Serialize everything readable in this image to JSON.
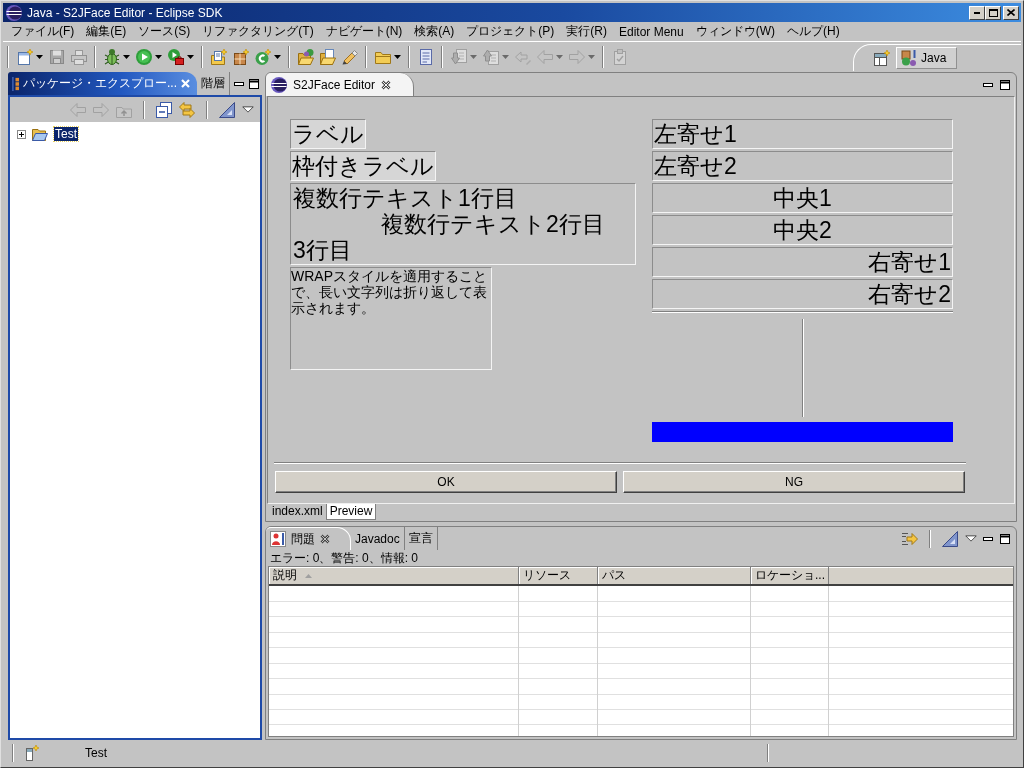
{
  "window": {
    "title": "Java - S2JFace Editor - Eclipse SDK"
  },
  "menu": [
    "ファイル(F)",
    "編集(E)",
    "ソース(S)",
    "リファクタリング(T)",
    "ナビゲート(N)",
    "検索(A)",
    "プロジェクト(P)",
    "実行(R)",
    "Editor Menu",
    "ウィンドウ(W)",
    "ヘルプ(H)"
  ],
  "toolbar": [
    {
      "items": [
        {
          "kind": "new",
          "dropdown": true,
          "disabled": false
        },
        {
          "kind": "save",
          "dropdown": false,
          "disabled": true
        },
        {
          "kind": "print",
          "dropdown": false,
          "disabled": true
        }
      ]
    },
    {
      "items": [
        {
          "kind": "debug",
          "dropdown": true,
          "disabled": false
        },
        {
          "kind": "run",
          "dropdown": true,
          "disabled": false
        },
        {
          "kind": "external-tools",
          "dropdown": true,
          "disabled": false
        }
      ]
    },
    {
      "items": [
        {
          "kind": "new-project",
          "dropdown": false,
          "disabled": false
        },
        {
          "kind": "new-package",
          "dropdown": false,
          "disabled": false
        },
        {
          "kind": "new-class",
          "dropdown": true,
          "disabled": false
        }
      ]
    },
    {
      "items": [
        {
          "kind": "open-type",
          "dropdown": false,
          "disabled": false
        },
        {
          "kind": "open-resource",
          "dropdown": false,
          "disabled": false
        },
        {
          "kind": "brush",
          "dropdown": false,
          "disabled": false
        }
      ]
    },
    {
      "items": [
        {
          "kind": "folder",
          "dropdown": true,
          "disabled": false
        }
      ]
    },
    {
      "items": [
        {
          "kind": "tasks",
          "dropdown": false,
          "disabled": false
        }
      ]
    },
    {
      "items": [
        {
          "kind": "next",
          "dropdown": true,
          "disabled": true
        },
        {
          "kind": "prev",
          "dropdown": true,
          "disabled": true
        },
        {
          "kind": "last-edit",
          "dropdown": false,
          "disabled": true
        },
        {
          "kind": "back",
          "dropdown": true,
          "disabled": true
        },
        {
          "kind": "forward",
          "dropdown": true,
          "disabled": true
        }
      ]
    },
    {
      "items": [
        {
          "kind": "pin",
          "dropdown": false,
          "disabled": true
        }
      ]
    }
  ],
  "perspectives": [
    {
      "label": "Java",
      "selected": true
    }
  ],
  "left_view": {
    "tabs": [
      {
        "label": "パッケージ・エクスプロー...",
        "selected": true
      },
      {
        "label": "階層",
        "selected": false
      }
    ],
    "toolbar": [
      {
        "items": [
          {
            "kind": "back",
            "disabled": true
          },
          {
            "kind": "forward",
            "disabled": true
          },
          {
            "kind": "up",
            "disabled": true
          }
        ]
      },
      {
        "items": [
          {
            "kind": "collapse-all",
            "disabled": false
          },
          {
            "kind": "link",
            "disabled": false
          }
        ]
      },
      {
        "items": [
          {
            "kind": "set-square",
            "disabled": false
          },
          {
            "kind": "view-menu",
            "disabled": false
          }
        ]
      }
    ],
    "tree": [
      {
        "label": "Test",
        "selected": true,
        "expanded": false
      }
    ]
  },
  "editor": {
    "tabs": [
      {
        "label": "S2JFace Editor",
        "selected": true
      }
    ],
    "preview": {
      "labels": [
        "ラベル",
        "枠付きラベル"
      ],
      "multiline_lines": [
        {
          "text": "複数行テキスト1行目",
          "indented": false
        },
        {
          "text": "複数行テキスト2行目",
          "indented": true
        },
        {
          "text": "3行目",
          "indented": false
        }
      ],
      "wrap_text": "WRAPスタイルを適用することで、長い文字列は折り返して表示されます。",
      "aligned_labels": [
        {
          "text": "左寄せ1",
          "kind": "left"
        },
        {
          "text": "左寄せ2",
          "kind": "left"
        },
        {
          "text": "中央1",
          "kind": "center"
        },
        {
          "text": "中央2",
          "kind": "center"
        },
        {
          "text": "右寄せ1",
          "kind": "right"
        },
        {
          "text": "右寄せ2",
          "kind": "right"
        }
      ],
      "buttons": [
        "OK",
        "NG"
      ]
    },
    "pages": [
      {
        "label": "index.xml",
        "selected": false
      },
      {
        "label": "Preview",
        "selected": true
      }
    ]
  },
  "bottom_view": {
    "tabs": [
      {
        "label": "問題",
        "selected": true
      },
      {
        "label": "Javadoc",
        "selected": false
      },
      {
        "label": "宣言",
        "selected": false
      }
    ],
    "toolbar": [
      {
        "items": [
          {
            "kind": "filter",
            "disabled": false
          }
        ]
      },
      {
        "items": [
          {
            "kind": "set-square",
            "disabled": false
          },
          {
            "kind": "view-menu",
            "disabled": false
          }
        ]
      }
    ],
    "summary": "エラー: 0、警告: 0、情報: 0",
    "table": {
      "columns": [
        {
          "label": "説明",
          "sorted": true
        },
        {
          "label": "リソース",
          "sorted": false
        },
        {
          "label": "パス",
          "sorted": false
        },
        {
          "label": "ロケーショ...",
          "sorted": false
        }
      ]
    }
  },
  "status_bar": {
    "text": "Test"
  }
}
